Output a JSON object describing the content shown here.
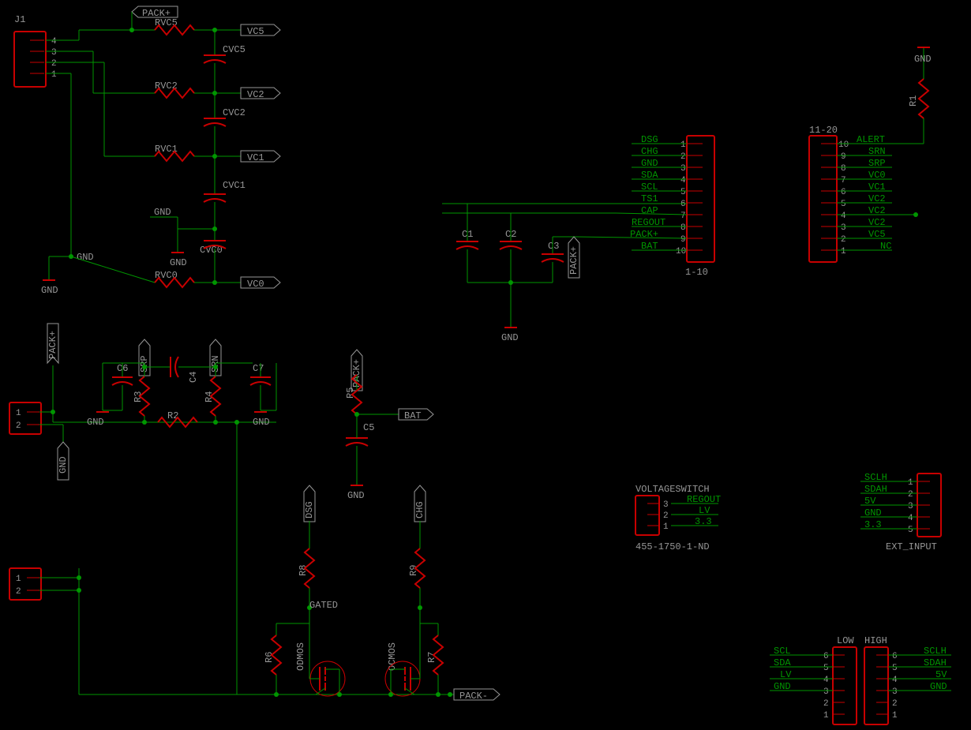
{
  "labels": {
    "J1": "J1",
    "PACKp": "PACK+",
    "PACKm": "PACK-",
    "VC5": "VC5",
    "VC2": "VC2",
    "VC1": "VC1",
    "VC0": "VC0",
    "RVC5": "RVC5",
    "RVC2": "RVC2",
    "RVC1": "RVC1",
    "RVC0": "RVC0",
    "CVC5": "CVC5",
    "CVC2": "CVC2",
    "CVC1": "CVC1",
    "CVC0": "CVC0",
    "GND": "GND",
    "SRP": "SRP",
    "SRN": "SRN",
    "C1": "C1",
    "C2": "C2",
    "C3": "C3",
    "C4": "C4",
    "C5": "C5",
    "C6": "C6",
    "C7": "C7",
    "R1": "R1",
    "R2": "R2",
    "R3": "R3",
    "R4": "R4",
    "R5": "R5",
    "R6": "R6",
    "R7": "R7",
    "R8": "R8",
    "R9": "R9",
    "BAT": "BAT",
    "DSG": "DSG",
    "CHG": "CHG",
    "GATED": "GATED",
    "ODMOS": "ODMOS",
    "OCMOS": "OCMOS",
    "REGOUT": "REGOUT",
    "LV": "LV",
    "3v3": "3.3",
    "VOLTAGESWITCH": "VOLTAGESWITCH",
    "partno": "455-1750-1-ND",
    "SCLH": "SCLH",
    "SDAH": "SDAH",
    "5V": "5V",
    "EXT_INPUT": "EXT_INPUT",
    "LOW": "LOW",
    "HIGH": "HIGH",
    "SCL": "SCL",
    "SDA": "SDA",
    "ALERT": "ALERT",
    "NC": "NC",
    "VC0_n": "VC0",
    "VC1_n": "VC1",
    "VC2a": "VC2",
    "VC2b": "VC2",
    "VC2c": "VC2",
    "VC5_n": "VC5",
    "SRN_n": "SRN",
    "SRP_n": "SRP",
    "DSG_n": "DSG",
    "CHG_n": "CHG",
    "GND_n": "GND",
    "SDA_n": "SDA",
    "SCL_n": "SCL",
    "TS1": "TS1",
    "CAP": "CAP",
    "REGOUT_n": "REGOUT",
    "PACKp_n": "PACK+",
    "BAT_n": "BAT",
    "hdr1_10": "1-10",
    "hdr11_20": "11-20"
  },
  "pins": {
    "p1": "1",
    "p2": "2",
    "p3": "3",
    "p4": "4",
    "p5": "5",
    "p6": "6",
    "p7": "7",
    "p8": "8",
    "p9": "9",
    "p10": "10"
  }
}
